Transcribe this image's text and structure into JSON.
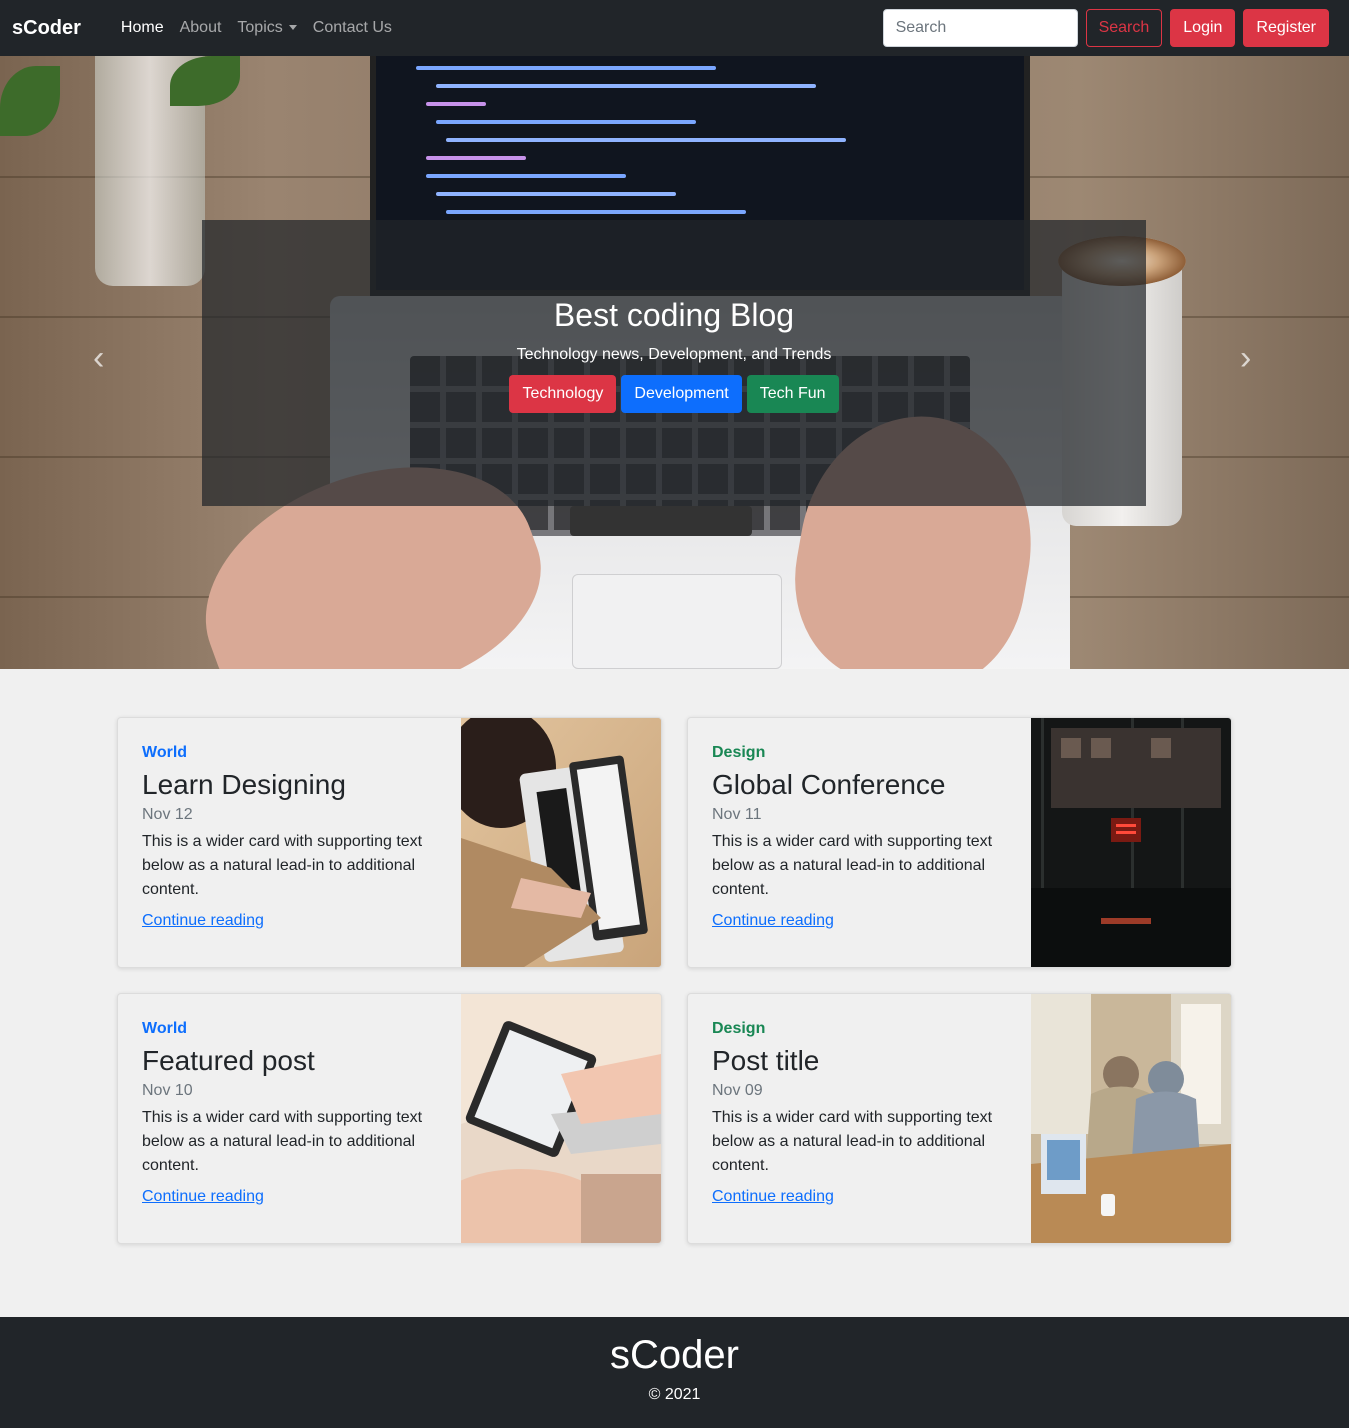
{
  "nav": {
    "brand": "sCoder",
    "links": [
      {
        "label": "Home",
        "active": true
      },
      {
        "label": "About"
      },
      {
        "label": "Topics",
        "dropdown": true
      },
      {
        "label": "Contact Us"
      }
    ],
    "search_placeholder": "Search",
    "search_button": "Search",
    "login": "Login",
    "register": "Register"
  },
  "hero": {
    "title": "Best coding Blog",
    "subtitle": "Technology news, Development, and Trends",
    "buttons": [
      "Technology",
      "Development",
      "Tech Fun"
    ],
    "prev_icon": "chevron-left-icon",
    "next_icon": "chevron-right-icon"
  },
  "cards": [
    {
      "category": "World",
      "category_color": "#0d6efd",
      "title": "Learn Designing",
      "date": "Nov 12",
      "text": "This is a wider card with supporting text below as a natural lead-in to additional content.",
      "link": "Continue reading"
    },
    {
      "category": "Design",
      "category_color": "#198754",
      "title": "Global Conference",
      "date": "Nov 11",
      "text": "This is a wider card with supporting text below as a natural lead-in to additional content.",
      "link": "Continue reading"
    },
    {
      "category": "World",
      "category_color": "#0d6efd",
      "title": "Featured post",
      "date": "Nov 10",
      "text": "This is a wider card with supporting text below as a natural lead-in to additional content.",
      "link": "Continue reading"
    },
    {
      "category": "Design",
      "category_color": "#198754",
      "title": "Post title",
      "date": "Nov 09",
      "text": "This is a wider card with supporting text below as a natural lead-in to additional content.",
      "link": "Continue reading"
    }
  ],
  "footer": {
    "brand": "sCoder",
    "copyright": "© 2021"
  },
  "colors": {
    "navbar": "#212529",
    "danger": "#dc3545",
    "primary": "#0d6efd",
    "success": "#198754"
  }
}
